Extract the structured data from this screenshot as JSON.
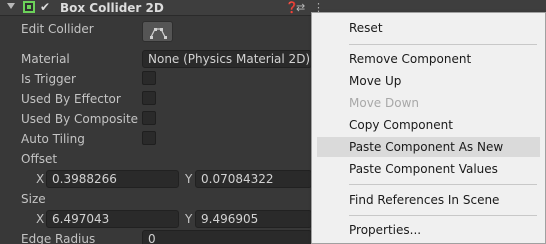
{
  "inspector": {
    "title": "Box Collider 2D",
    "rows": {
      "edit_collider": "Edit Collider",
      "material": "Material",
      "material_value": "None (Physics Material 2D)",
      "is_trigger": "Is Trigger",
      "used_by_effector": "Used By Effector",
      "used_by_composite": "Used By Composite",
      "auto_tiling": "Auto Tiling",
      "offset": "Offset",
      "offset_x_label": "X",
      "offset_x": "0.3988266",
      "offset_y_label": "Y",
      "offset_y": "0.07084322",
      "size": "Size",
      "size_x_label": "X",
      "size_x": "6.497043",
      "size_y_label": "Y",
      "size_y": "9.496905",
      "edge_radius": "Edge Radius",
      "edge_radius_value": "0"
    },
    "checkboxes": {
      "is_trigger": false,
      "used_by_effector": false,
      "used_by_composite": false,
      "auto_tiling": false
    },
    "icon_names": [
      "foldout-arrow-icon",
      "box-collider-icon",
      "checkmark-icon",
      "help-icon",
      "presets-icon",
      "kebab-menu-icon",
      "edit-collider-icon"
    ]
  },
  "context_menu": {
    "items": {
      "reset": "Reset",
      "remove_component": "Remove Component",
      "move_up": "Move Up",
      "move_down": "Move Down",
      "copy_component": "Copy Component",
      "paste_as_new": "Paste Component As New",
      "paste_values": "Paste Component Values",
      "find_references": "Find References In Scene",
      "properties": "Properties..."
    },
    "highlighted": "Paste Component As New",
    "disabled": [
      "Move Down"
    ]
  },
  "colors": {
    "inspector_bg": "#383838",
    "field_bg": "#2a2a2a",
    "collider_icon": "#6cd25a",
    "menu_bg": "#f0f0f0",
    "menu_hover": "#dadada"
  }
}
